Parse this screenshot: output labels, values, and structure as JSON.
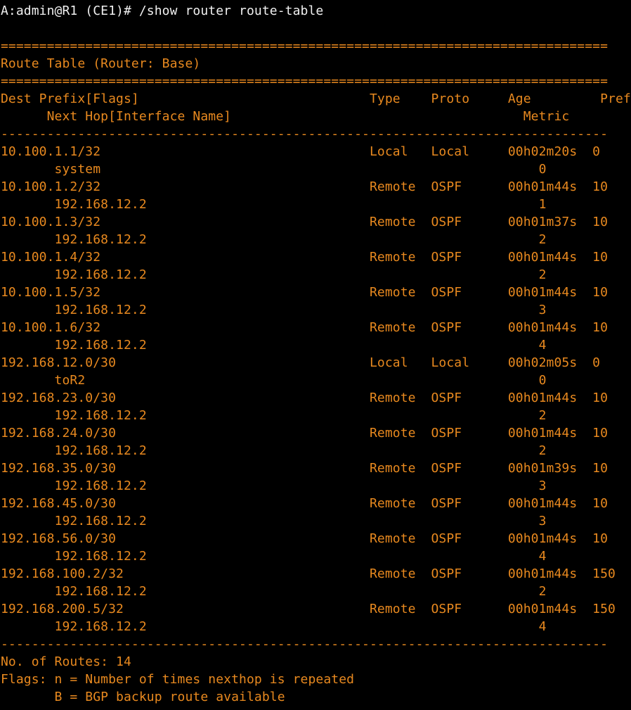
{
  "theme": {
    "background": "#000000",
    "output_color": "#e8891f",
    "prompt_color": "#f0f0f0"
  },
  "terminal": {
    "prompt": "A:admin@R1 (CE1)# /show router route-table",
    "header": {
      "rule_top": "===============================================================================",
      "title": "Route Table (Router: Base)",
      "rule_bottom": "===============================================================================",
      "columns_line1": "Dest Prefix[Flags]                              Type    Proto     Age         Pref",
      "columns_line2": "      Next Hop[Interface Name]                                      Metric",
      "rule_sep": "-------------------------------------------------------------------------------"
    },
    "routes": [
      {
        "line1": "10.100.1.1/32                                   Local   Local     00h02m20s  0",
        "line2": "       system                                                         0"
      },
      {
        "line1": "10.100.1.2/32                                   Remote  OSPF      00h01m44s  10",
        "line2": "       192.168.12.2                                                   1"
      },
      {
        "line1": "10.100.1.3/32                                   Remote  OSPF      00h01m37s  10",
        "line2": "       192.168.12.2                                                   2"
      },
      {
        "line1": "10.100.1.4/32                                   Remote  OSPF      00h01m44s  10",
        "line2": "       192.168.12.2                                                   2"
      },
      {
        "line1": "10.100.1.5/32                                   Remote  OSPF      00h01m44s  10",
        "line2": "       192.168.12.2                                                   3"
      },
      {
        "line1": "10.100.1.6/32                                   Remote  OSPF      00h01m44s  10",
        "line2": "       192.168.12.2                                                   4"
      },
      {
        "line1": "192.168.12.0/30                                 Local   Local     00h02m05s  0",
        "line2": "       toR2                                                           0"
      },
      {
        "line1": "192.168.23.0/30                                 Remote  OSPF      00h01m44s  10",
        "line2": "       192.168.12.2                                                   2"
      },
      {
        "line1": "192.168.24.0/30                                 Remote  OSPF      00h01m44s  10",
        "line2": "       192.168.12.2                                                   2"
      },
      {
        "line1": "192.168.35.0/30                                 Remote  OSPF      00h01m39s  10",
        "line2": "       192.168.12.2                                                   3"
      },
      {
        "line1": "192.168.45.0/30                                 Remote  OSPF      00h01m44s  10",
        "line2": "       192.168.12.2                                                   3"
      },
      {
        "line1": "192.168.56.0/30                                 Remote  OSPF      00h01m44s  10",
        "line2": "       192.168.12.2                                                   4"
      },
      {
        "line1": "192.168.100.2/32                                Remote  OSPF      00h01m44s  150",
        "line2": "       192.168.12.2                                                   2"
      },
      {
        "line1": "192.168.200.5/32                                Remote  OSPF      00h01m44s  150",
        "line2": "       192.168.12.2                                                   4"
      }
    ],
    "footer": {
      "rule": "-------------------------------------------------------------------------------",
      "count": "No. of Routes: 14",
      "flags_line1": "Flags: n = Number of times nexthop is repeated",
      "flags_line2": "       B = BGP backup route available"
    }
  }
}
